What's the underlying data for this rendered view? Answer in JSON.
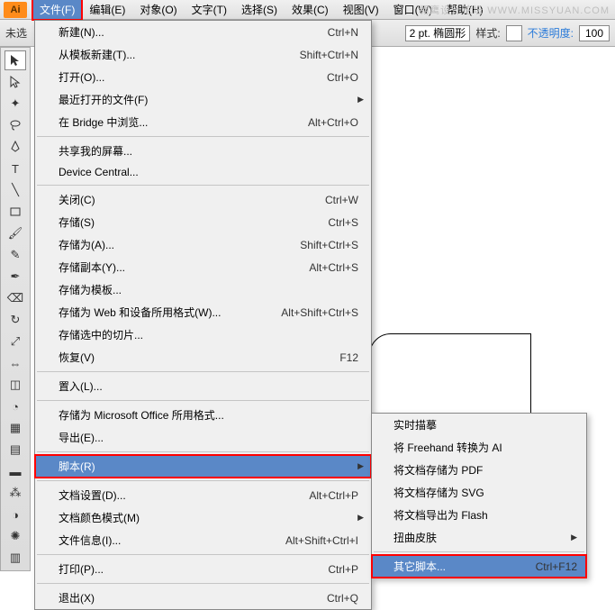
{
  "app_icon": "Ai",
  "watermark": "翱鹰设计论坛 WWW.MISSYUAN.COM",
  "menubar": [
    {
      "label": "文件(F)"
    },
    {
      "label": "编辑(E)"
    },
    {
      "label": "对象(O)"
    },
    {
      "label": "文字(T)"
    },
    {
      "label": "选择(S)"
    },
    {
      "label": "效果(C)"
    },
    {
      "label": "视图(V)"
    },
    {
      "label": "窗口(W)"
    },
    {
      "label": "帮助(H)"
    }
  ],
  "toolbar": {
    "untitled": "未选",
    "stroke_val": "2 pt. 椭圆形",
    "style_label": "样式:",
    "opacity_label": "不透明度:",
    "opacity_val": "100"
  },
  "file_menu": [
    {
      "label": "新建(N)...",
      "sc": "Ctrl+N",
      "arrow": false
    },
    {
      "label": "从模板新建(T)...",
      "sc": "Shift+Ctrl+N",
      "arrow": false
    },
    {
      "label": "打开(O)...",
      "sc": "Ctrl+O",
      "arrow": false
    },
    {
      "label": "最近打开的文件(F)",
      "sc": "",
      "arrow": true
    },
    {
      "label": "在 Bridge 中浏览...",
      "sc": "Alt+Ctrl+O",
      "arrow": false
    },
    {
      "sep": true
    },
    {
      "label": "共享我的屏幕...",
      "sc": "",
      "arrow": false
    },
    {
      "label": "Device Central...",
      "sc": "",
      "arrow": false
    },
    {
      "sep": true
    },
    {
      "label": "关闭(C)",
      "sc": "Ctrl+W",
      "arrow": false
    },
    {
      "label": "存储(S)",
      "sc": "Ctrl+S",
      "arrow": false
    },
    {
      "label": "存储为(A)...",
      "sc": "Shift+Ctrl+S",
      "arrow": false
    },
    {
      "label": "存储副本(Y)...",
      "sc": "Alt+Ctrl+S",
      "arrow": false
    },
    {
      "label": "存储为模板...",
      "sc": "",
      "arrow": false
    },
    {
      "label": "存储为 Web 和设备所用格式(W)...",
      "sc": "Alt+Shift+Ctrl+S",
      "arrow": false
    },
    {
      "label": "存储选中的切片...",
      "sc": "",
      "arrow": false
    },
    {
      "label": "恢复(V)",
      "sc": "F12",
      "arrow": false
    },
    {
      "sep": true
    },
    {
      "label": "置入(L)...",
      "sc": "",
      "arrow": false
    },
    {
      "sep": true
    },
    {
      "label": "存储为 Microsoft Office 所用格式...",
      "sc": "",
      "arrow": false
    },
    {
      "label": "导出(E)...",
      "sc": "",
      "arrow": false
    },
    {
      "sep": true
    },
    {
      "label": "脚本(R)",
      "sc": "",
      "arrow": true,
      "hover": true,
      "hl": true
    },
    {
      "sep": true
    },
    {
      "label": "文档设置(D)...",
      "sc": "Alt+Ctrl+P",
      "arrow": false
    },
    {
      "label": "文档颜色模式(M)",
      "sc": "",
      "arrow": true
    },
    {
      "label": "文件信息(I)...",
      "sc": "Alt+Shift+Ctrl+I",
      "arrow": false
    },
    {
      "sep": true
    },
    {
      "label": "打印(P)...",
      "sc": "Ctrl+P",
      "arrow": false
    },
    {
      "sep": true
    },
    {
      "label": "退出(X)",
      "sc": "Ctrl+Q",
      "arrow": false
    }
  ],
  "scripts_submenu": [
    {
      "label": "实时描摹",
      "sc": "",
      "arrow": false
    },
    {
      "label": "将 Freehand 转换为 AI",
      "sc": "",
      "arrow": false
    },
    {
      "label": "将文档存储为 PDF",
      "sc": "",
      "arrow": false
    },
    {
      "label": "将文档存储为 SVG",
      "sc": "",
      "arrow": false
    },
    {
      "label": "将文档导出为 Flash",
      "sc": "",
      "arrow": false
    },
    {
      "label": "扭曲皮肤",
      "sc": "",
      "arrow": true
    },
    {
      "sep": true
    },
    {
      "label": "其它脚本...",
      "sc": "Ctrl+F12",
      "arrow": false,
      "hover": true,
      "hl": true
    }
  ]
}
